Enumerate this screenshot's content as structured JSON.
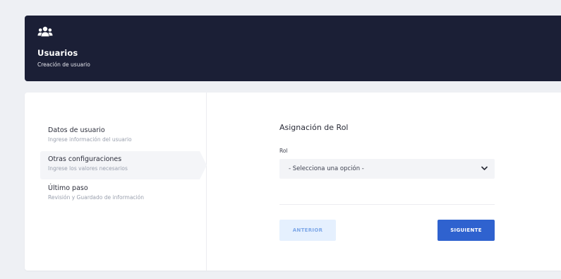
{
  "header": {
    "icon": "users-icon",
    "title": "Usuarios",
    "subtitle": "Creación de usuario"
  },
  "steps": [
    {
      "title": "Datos de usuario",
      "description": "Ingrese información del usuario"
    },
    {
      "title": "Otras configuraciones",
      "description": "Ingrese los valores necesarios",
      "active": true
    },
    {
      "title": "Último paso",
      "description": "Revisión y Guardado de información"
    }
  ],
  "form": {
    "title": "Asignación de Rol",
    "role_label": "Rol",
    "role_select_value": "- Selecciona una opción -",
    "select_icon": "chevron-down-icon"
  },
  "buttons": {
    "previous": "ANTERIOR",
    "next": "SIGUIENTE"
  },
  "colors": {
    "header_bg": "#1b1f36",
    "primary": "#2f62cf",
    "primary_light": "#e5f0fe",
    "page_bg": "#eef0f4"
  }
}
